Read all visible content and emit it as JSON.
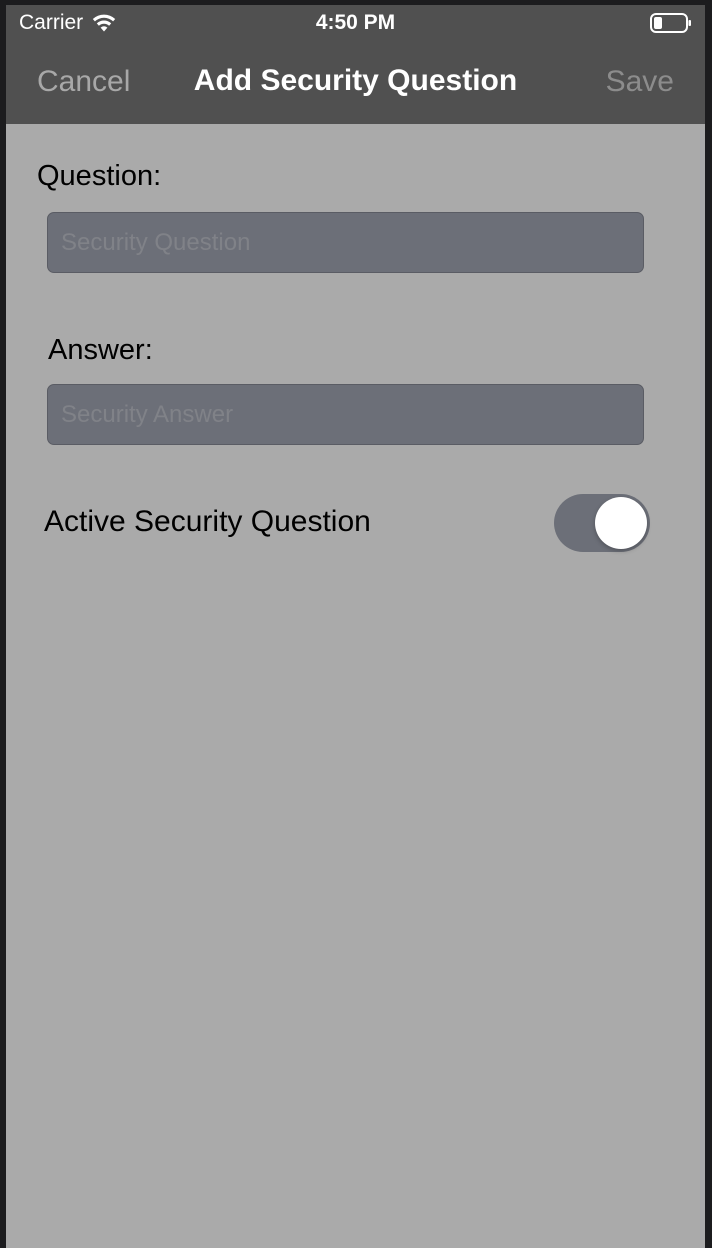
{
  "status_bar": {
    "carrier": "Carrier",
    "time": "4:50 PM",
    "wifi_icon": "wifi-icon",
    "battery_icon": "battery-icon"
  },
  "nav": {
    "cancel_label": "Cancel",
    "title": "Add Security Question",
    "save_label": "Save"
  },
  "form": {
    "question_label": "Question:",
    "question_placeholder": "Security Question",
    "question_value": "",
    "answer_label": "Answer:",
    "answer_placeholder": "Security Answer",
    "answer_value": "",
    "active_label": "Active Security Question",
    "active_toggle_on": true
  },
  "colors": {
    "background": "#aaaaaa",
    "header": "#505050",
    "field": "#6c6f78",
    "toggle_track": "#6c6f78"
  }
}
